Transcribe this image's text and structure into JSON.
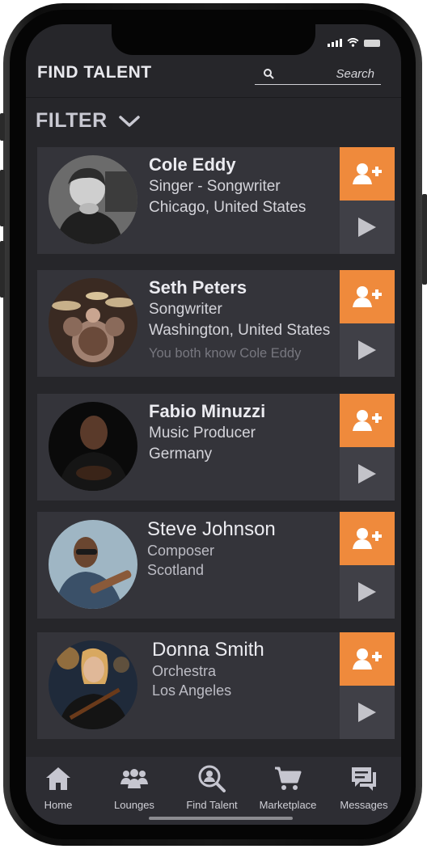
{
  "header": {
    "title": "FIND TALENT",
    "search_placeholder": "Search"
  },
  "filter": {
    "label": "FILTER"
  },
  "talents": [
    {
      "name": "Cole Eddy",
      "role": "Singer - Songwriter",
      "location": "Chicago, United States",
      "mutual": ""
    },
    {
      "name": "Seth Peters",
      "role": "Songwriter",
      "location": "Washington, United States",
      "mutual": "You both know Cole Eddy"
    },
    {
      "name": "Fabio Minuzzi",
      "role": "Music Producer",
      "location": "Germany",
      "mutual": ""
    },
    {
      "name": "Steve Johnson",
      "role": "Composer",
      "location": "Scotland",
      "mutual": ""
    },
    {
      "name": "Donna Smith",
      "role": "Orchestra",
      "location": "Los Angeles",
      "mutual": ""
    }
  ],
  "nav": [
    {
      "label": "Home",
      "icon": "home-icon"
    },
    {
      "label": "Lounges",
      "icon": "users-icon"
    },
    {
      "label": "Find Talent",
      "icon": "search-person-icon"
    },
    {
      "label": "Marketplace",
      "icon": "cart-icon"
    },
    {
      "label": "Messages",
      "icon": "messages-icon"
    }
  ],
  "colors": {
    "accent": "#ef8a3c",
    "background": "#26262a",
    "card": "#34343a"
  }
}
